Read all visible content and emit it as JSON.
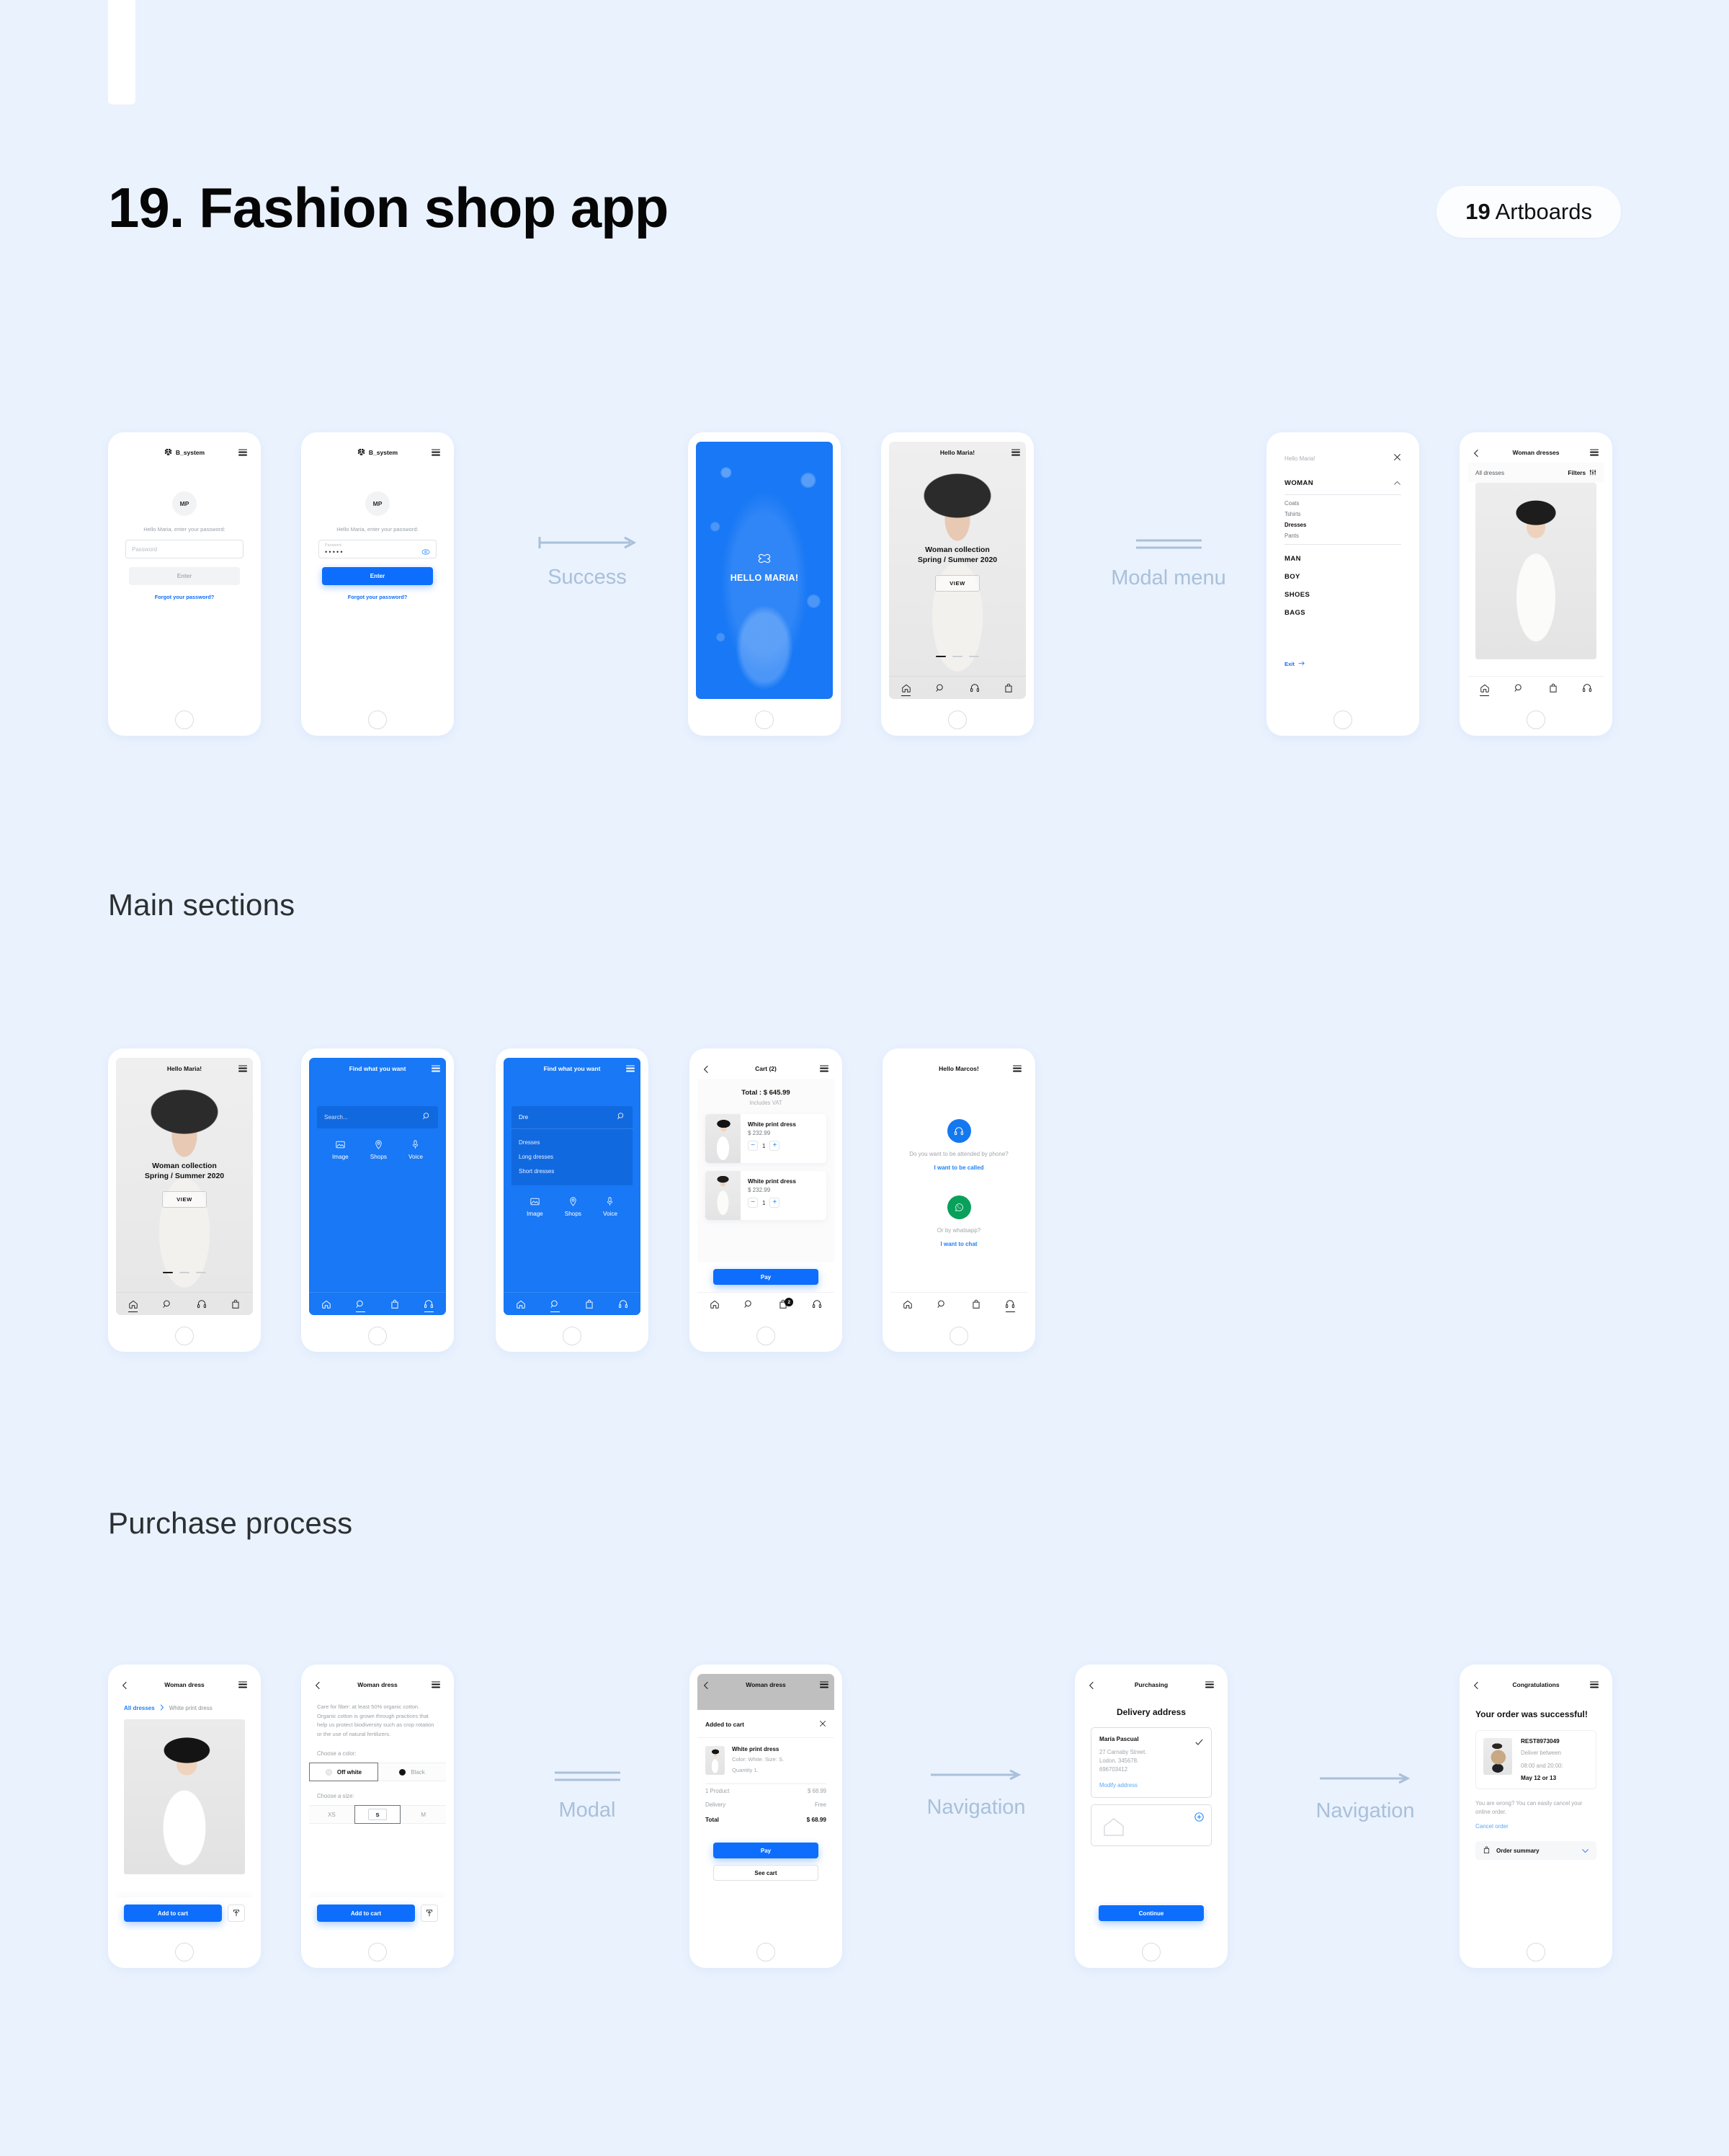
{
  "header": {
    "title": "19. Fashion shop app",
    "badge_count": "19",
    "badge_label": "Artboards"
  },
  "sections": [
    {
      "id": "flow",
      "title": ""
    },
    {
      "id": "main",
      "title": "Main sections"
    },
    {
      "id": "purchase",
      "title": "Purchase process"
    }
  ],
  "connectors": [
    {
      "id": "success",
      "label": "Success",
      "kind": "arrow"
    },
    {
      "id": "modal-menu",
      "label": "Modal menu",
      "kind": "double-line"
    },
    {
      "id": "modal",
      "label": "Modal",
      "kind": "double-line"
    },
    {
      "id": "navigation-1",
      "label": "Navigation",
      "kind": "arrow-plain"
    },
    {
      "id": "navigation-2",
      "label": "Navigation",
      "kind": "arrow-plain"
    }
  ],
  "colors": {
    "canvas": "#eaf2fe",
    "brand_blue": "#0d6efd",
    "splash_blue": "#1878f5",
    "whatsapp_green": "#08a05a",
    "connector": "#a9c0da"
  },
  "screens": {
    "login_empty": {
      "brand": "B_system",
      "avatar_initials": "MP",
      "greeting": "Hello Maria, enter your password:",
      "password_placeholder": "Password",
      "password_value": "",
      "enter_label": "Enter",
      "forgot_label": "Forgot your password?"
    },
    "login_filled": {
      "brand": "B_system",
      "avatar_initials": "MP",
      "greeting": "Hello Maria, enter your password:",
      "password_label": "Password",
      "password_value": "•••••",
      "enter_label": "Enter",
      "forgot_label": "Forgot your password?"
    },
    "splash": {
      "title": "HELLO MARIA!"
    },
    "collection": {
      "topbar_title": "Hello Maria!",
      "headline_1": "Woman collection",
      "headline_2": "Spring / Summer 2020",
      "view_label": "VIEW",
      "carousel_active_index": 0,
      "carousel_count": 3,
      "nav": [
        "home",
        "search",
        "support",
        "cart"
      ],
      "nav_selected": "home"
    },
    "modal_menu": {
      "topbar_title": "Hello Maria!",
      "expanded_section": "WOMAN",
      "woman_items": [
        "Coats",
        "Tshirts",
        "Dresses",
        "Pants"
      ],
      "woman_active_item": "Dresses",
      "sections": [
        "MAN",
        "BOY",
        "SHOES",
        "BAGS"
      ],
      "exit_label": "Exit"
    },
    "listing": {
      "topbar_title": "Woman dresses",
      "filter_left": "All dresses",
      "filter_right": "Filters",
      "nav_selected": "home"
    },
    "search_empty": {
      "topbar_title": "Find what you want",
      "search_placeholder": "Search...",
      "search_value": "",
      "quick_actions": [
        "Image",
        "Shops",
        "Voice"
      ],
      "nav_selected": "search"
    },
    "search_typing": {
      "topbar_title": "Find what you want",
      "search_value": "Dre",
      "suggestions": [
        "Dresses",
        "Long dresses",
        "Short dresses"
      ],
      "quick_actions": [
        "Image",
        "Shops",
        "Voice"
      ],
      "nav_selected": "search"
    },
    "cart": {
      "topbar_title": "Cart (2)",
      "total_label": "Total : $ 645.99",
      "vat_label": "Includes VAT",
      "items": [
        {
          "name": "White print dress",
          "price": "$ 232.99",
          "qty": "1"
        },
        {
          "name": "White print dress",
          "price": "$ 232.99",
          "qty": "1"
        }
      ],
      "pay_label": "Pay",
      "cart_badge": "2",
      "nav_selected": "cart"
    },
    "support": {
      "topbar_title": "Hello Marcos!",
      "phone_question": "Do you want to be attended by phone?",
      "phone_action": "I want to be called",
      "chat_question": "Or by whatsapp?",
      "chat_action": "I want to chat",
      "nav_selected": "support"
    },
    "pdp": {
      "topbar_title": "Woman dress",
      "breadcrumb_root": "All dresses",
      "breadcrumb_current": "White print dress",
      "add_to_cart_label": "Add to cart"
    },
    "pdp_options": {
      "topbar_title": "Woman dress",
      "description": "Care for fiber: at least 50% organic cotton. Organic cotton is grown through practices that help us protect biodiversity such as crop rotation or the use of natural fertilizers.",
      "color_label": "Choose a color:",
      "colors": [
        "Off white",
        "Black"
      ],
      "color_selected": "Off white",
      "size_label": "Choose a size:",
      "sizes": [
        "XS",
        "S",
        "M"
      ],
      "size_selected": "S",
      "add_to_cart_label": "Add to cart"
    },
    "added_modal": {
      "topbar_title": "Woman dress",
      "sheet_title": "Added to cart",
      "item_name": "White print dress",
      "item_meta_1": "Color: White. Size: S.",
      "item_meta_2": "Quantity 1.",
      "rows": [
        {
          "label": "1 Product",
          "value": "$ 68.99"
        },
        {
          "label": "Delivery",
          "value": "Free"
        }
      ],
      "total_label": "Total",
      "total_value": "$ 68.99",
      "pay_label": "Pay",
      "see_cart_label": "See cart"
    },
    "delivery": {
      "topbar_title": "Purchasing",
      "heading": "Delivery address",
      "name": "María Pascual",
      "address_line_1": "27 Carnaby Street.",
      "address_line_2": "Lodon. 345678.",
      "address_line_3": "696703412",
      "modify_label": "Modify address",
      "continue_label": "Continue"
    },
    "congrats": {
      "topbar_title": "Congratulations",
      "heading": "Your order was successful!",
      "order_id": "REST8973049",
      "deliver_line_1": "Deliver between",
      "deliver_line_2": "08:00 and 20:00:",
      "deliver_date": "May 12 or 13",
      "cancel_note": "You are wrong? You can easily cancel your online order.",
      "cancel_label": "Cancel order",
      "summary_label": "Order summary"
    }
  }
}
